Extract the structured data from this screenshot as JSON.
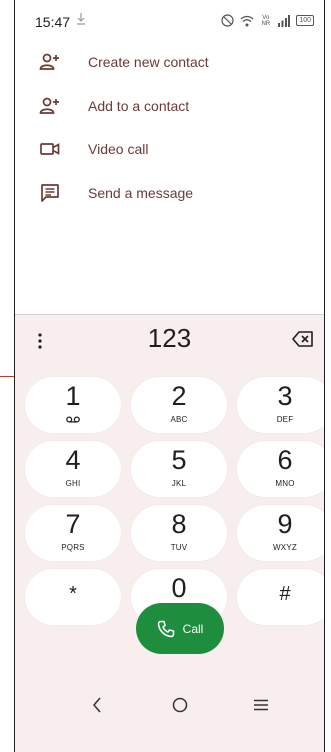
{
  "status": {
    "time": "15:47",
    "icons": [
      "download-icon",
      "vibrate-icon",
      "wifi-icon",
      "volte-icon",
      "signal-icon",
      "battery-icon"
    ],
    "network": "Vo\nNR",
    "battery": "100"
  },
  "actions": [
    {
      "label": "Create new contact",
      "icon": "add-person-icon"
    },
    {
      "label": "Add to a contact",
      "icon": "add-person-icon"
    },
    {
      "label": "Video call",
      "icon": "video-camera-icon"
    },
    {
      "label": "Send a message",
      "icon": "message-icon"
    }
  ],
  "dialer": {
    "number": "123",
    "keys": [
      {
        "digit": "1",
        "letters": ""
      },
      {
        "digit": "2",
        "letters": "ABC"
      },
      {
        "digit": "3",
        "letters": "DEF"
      },
      {
        "digit": "4",
        "letters": "GHI"
      },
      {
        "digit": "5",
        "letters": "JKL"
      },
      {
        "digit": "6",
        "letters": "MNO"
      },
      {
        "digit": "7",
        "letters": "PQRS"
      },
      {
        "digit": "8",
        "letters": "TUV"
      },
      {
        "digit": "9",
        "letters": "WXYZ"
      },
      {
        "digit": "*",
        "letters": ""
      },
      {
        "digit": "0",
        "letters": "+"
      },
      {
        "digit": "#",
        "letters": ""
      }
    ],
    "call_label": "Call"
  },
  "colors": {
    "accent": "#6b3a36",
    "call_green": "#1e8e3e",
    "dialpad_bg": "#f7eeed"
  }
}
